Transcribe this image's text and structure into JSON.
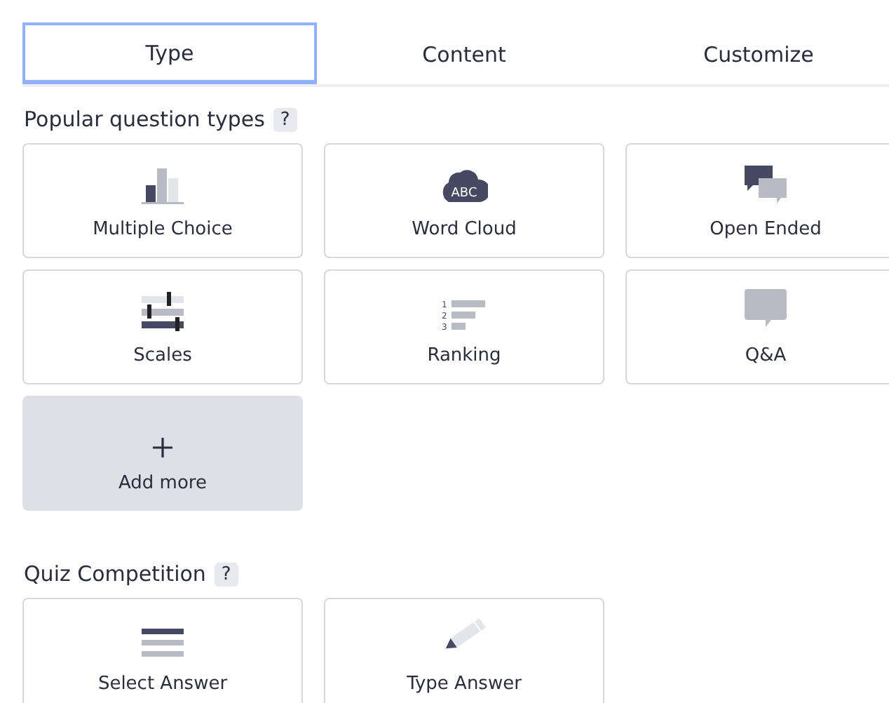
{
  "tabs": [
    {
      "label": "Type",
      "selected": true
    },
    {
      "label": "Content",
      "selected": false
    },
    {
      "label": "Customize",
      "selected": false
    }
  ],
  "sections": [
    {
      "title": "Popular question types",
      "help": "?",
      "cards": [
        {
          "kind": "type",
          "label": "Multiple Choice"
        },
        {
          "kind": "type",
          "label": "Word Cloud",
          "icon_text": "ABC"
        },
        {
          "kind": "type",
          "label": "Open Ended"
        },
        {
          "kind": "type",
          "label": "Scales"
        },
        {
          "kind": "type",
          "label": "Ranking",
          "icon_marks": [
            "1",
            "2",
            "3"
          ]
        },
        {
          "kind": "type",
          "label": "Q&A"
        },
        {
          "kind": "add",
          "label": "Add more"
        }
      ]
    },
    {
      "title": "Quiz Competition",
      "help": "?",
      "cards": [
        {
          "kind": "type",
          "label": "Select Answer"
        },
        {
          "kind": "type",
          "label": "Type Answer"
        }
      ]
    }
  ]
}
